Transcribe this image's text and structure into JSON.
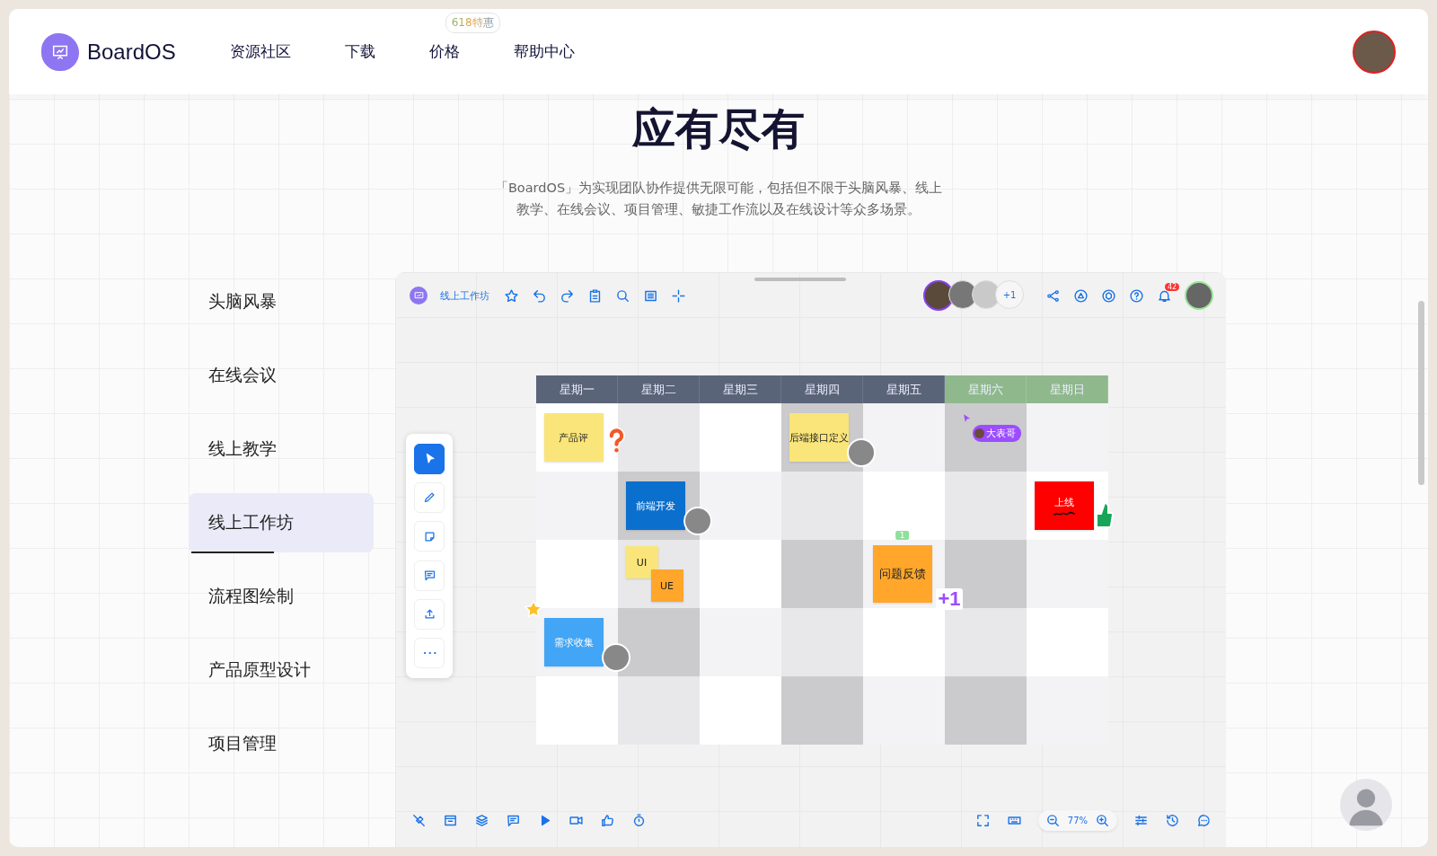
{
  "header": {
    "logo": "BoardOS",
    "nav": [
      {
        "label": "资源社区"
      },
      {
        "label": "下载"
      },
      {
        "label": "价格",
        "badge": "618特惠"
      },
      {
        "label": "帮助中心"
      }
    ]
  },
  "hero": {
    "title": "应有尽有",
    "description_lines": [
      "「BoardOS」为实现团队协作提供无限可能，包括但不限于头脑风暴、线上",
      "教学、在线会议、项目管理、敏捷工作流以及在线设计等众多场景。"
    ]
  },
  "scenes": [
    {
      "label": "头脑风暴",
      "selected": false
    },
    {
      "label": "在线会议",
      "selected": false
    },
    {
      "label": "线上教学",
      "selected": false
    },
    {
      "label": "线上工作坊",
      "selected": true
    },
    {
      "label": "流程图绘制",
      "selected": false
    },
    {
      "label": "产品原型设计",
      "selected": false
    },
    {
      "label": "项目管理",
      "selected": false
    }
  ],
  "board": {
    "title": "线上工作坊",
    "extra_members": "+1",
    "notifications": "42",
    "zoom": "77%",
    "tools": [
      {
        "selected": true
      },
      {
        "selected": false
      },
      {
        "selected": false
      },
      {
        "selected": false
      },
      {
        "selected": false
      },
      {
        "selected": false
      }
    ],
    "calendar": {
      "days": [
        {
          "label": "星期一",
          "weekend": false
        },
        {
          "label": "星期二",
          "weekend": false
        },
        {
          "label": "星期三",
          "weekend": false
        },
        {
          "label": "星期四",
          "weekend": false
        },
        {
          "label": "星期五",
          "weekend": false
        },
        {
          "label": "星期六",
          "weekend": true
        },
        {
          "label": "星期日",
          "weekend": true
        }
      ],
      "rows": [
        [
          {
            "notes": [
              {
                "text": "产品评",
                "color": "#fae57a",
                "kind": "regular",
                "question_sticker": true
              }
            ]
          },
          {},
          {},
          {
            "notes": [
              {
                "text": "后端接口定义",
                "color": "#fae57a",
                "kind": "regular",
                "avatar": true
              }
            ]
          },
          {},
          {
            "cursor": {
              "name": "大表哥"
            }
          },
          {}
        ],
        [
          {},
          {
            "notes": [
              {
                "text": "前端开发",
                "color": "#0b6fcd",
                "kind": "regular",
                "avatar": true
              }
            ]
          },
          {},
          {},
          {},
          {},
          {
            "notes": [
              {
                "text": "上线",
                "color": "#ff0000",
                "kind": "regular",
                "thumb_sticker": true
              }
            ]
          }
        ],
        [
          {},
          {
            "notes": [
              {
                "text": "UI",
                "color": "#fae57a",
                "kind": "small"
              },
              {
                "text": "UE",
                "color": "#ffa62b",
                "kind": "small"
              }
            ]
          },
          {},
          {},
          {
            "notes": [
              {
                "text": "问题反馈",
                "color": "#ffa62b",
                "kind": "large",
                "comments": "1",
                "plus_one": "+1"
              }
            ]
          },
          {},
          {}
        ],
        [
          {
            "notes": [
              {
                "text": "需求收集",
                "color": "#42a5f5",
                "kind": "regular",
                "star_sticker": true,
                "avatar": true
              }
            ]
          },
          {},
          {},
          {},
          {},
          {},
          {}
        ],
        [
          {},
          {},
          {},
          {},
          {},
          {},
          {}
        ]
      ]
    }
  }
}
